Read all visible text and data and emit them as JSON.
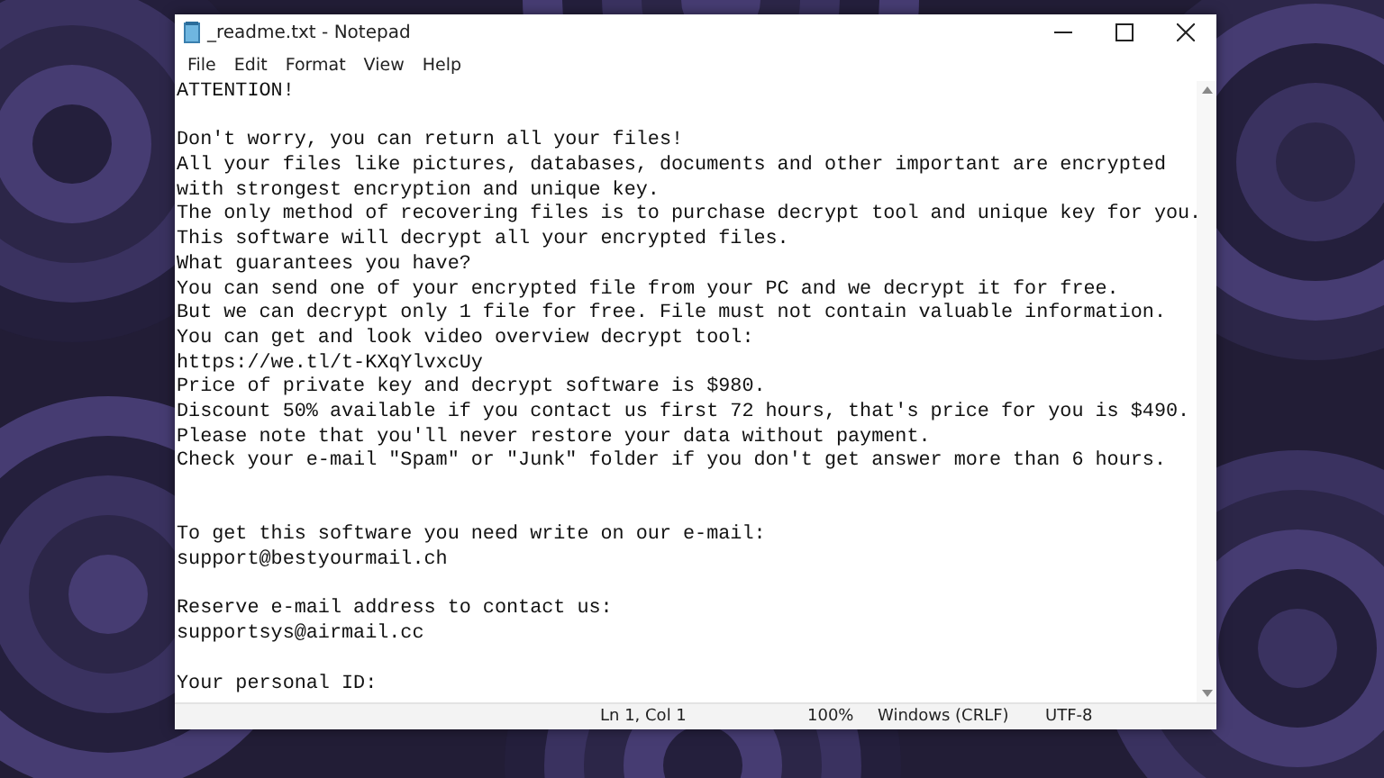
{
  "window": {
    "title": "_readme.txt - Notepad"
  },
  "menu": [
    "File",
    "Edit",
    "Format",
    "View",
    "Help"
  ],
  "lines": [
    {
      "kind": "text",
      "text": "ATTENTION!"
    },
    {
      "kind": "blank"
    },
    {
      "kind": "text",
      "text": "Don't worry, you can return all your files!"
    },
    {
      "kind": "text",
      "text": "All your files like pictures, databases, documents and other important are encrypted"
    },
    {
      "kind": "text",
      "text": "with strongest encryption and unique key."
    },
    {
      "kind": "text",
      "text": "The only method of recovering files is to purchase decrypt tool and unique key for you."
    },
    {
      "kind": "text",
      "text": "This software will decrypt all your encrypted files."
    },
    {
      "kind": "text",
      "text": "What guarantees you have?"
    },
    {
      "kind": "text",
      "text": "You can send one of your encrypted file from your PC and we decrypt it for free."
    },
    {
      "kind": "text",
      "text": "But we can decrypt only 1 file for free. File must not contain valuable information."
    },
    {
      "kind": "text",
      "text": "You can get and look video overview decrypt tool:"
    },
    {
      "kind": "text",
      "text": "https://we.tl/t-KXqYlvxcUy"
    },
    {
      "kind": "text",
      "text": "Price of private key and decrypt software is $980."
    },
    {
      "kind": "text",
      "text": "Discount 50% available if you contact us first 72 hours, that's price for you is $490."
    },
    {
      "kind": "text",
      "text": "Please note that you'll never restore your data without payment."
    },
    {
      "kind": "text",
      "text": "Check your e-mail \"Spam\" or \"Junk\" folder if you don't get answer more than 6 hours."
    },
    {
      "kind": "blank"
    },
    {
      "kind": "blank"
    },
    {
      "kind": "text",
      "text": "To get this software you need write on our e-mail:"
    },
    {
      "kind": "text",
      "text": "support@bestyourmail.ch"
    },
    {
      "kind": "blank"
    },
    {
      "kind": "text",
      "text": "Reserve e-mail address to contact us:"
    },
    {
      "kind": "text",
      "text": "supportsys@airmail.cc"
    },
    {
      "kind": "blank"
    },
    {
      "kind": "text",
      "text": "Your personal ID:"
    }
  ],
  "status_bar": {
    "position": "Ln 1, Col 1",
    "zoom": "100%",
    "line_endings": "Windows (CRLF)",
    "encoding": "UTF-8"
  }
}
